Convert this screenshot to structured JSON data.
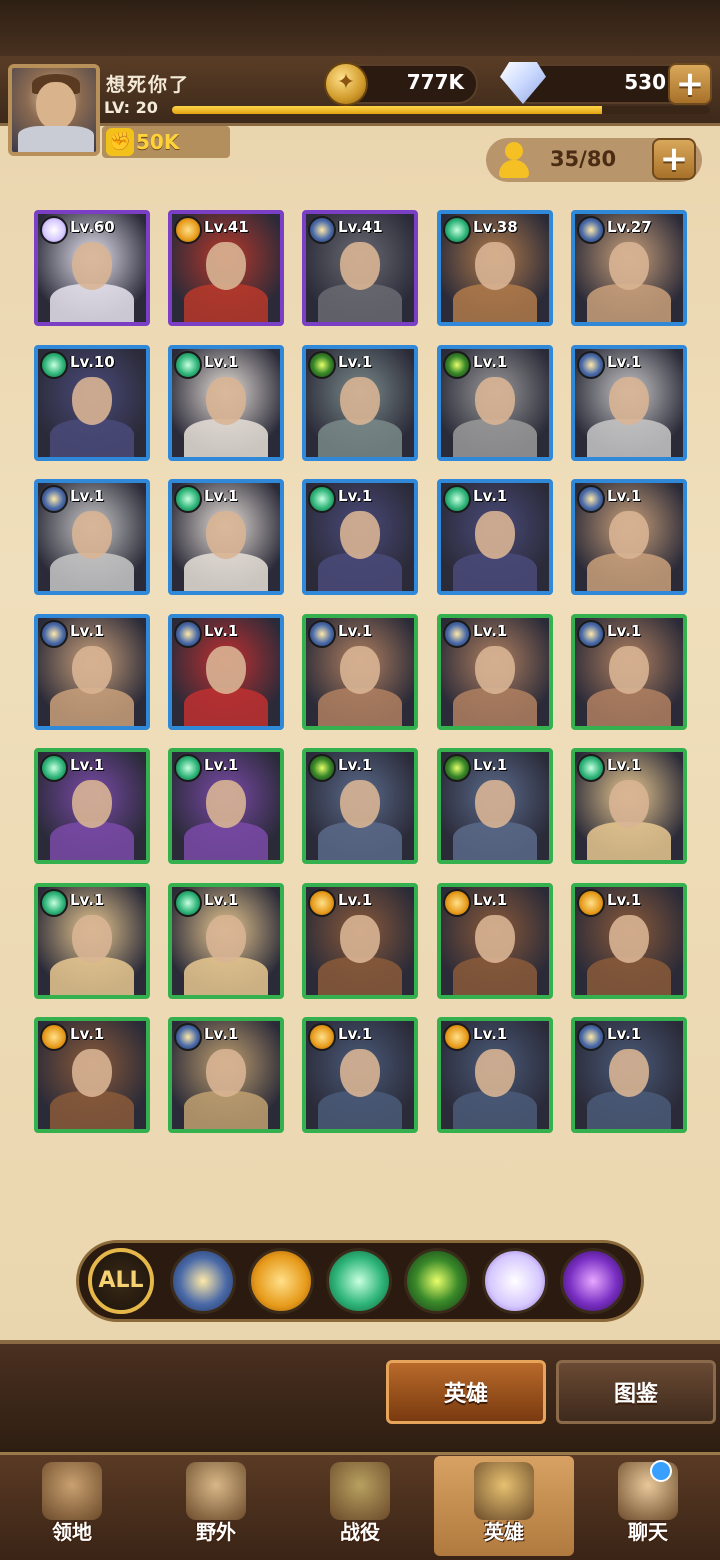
{
  "player": {
    "name": "想死你了",
    "level_label": "LV: 20",
    "xp_fraction": 0.8,
    "power": "50K"
  },
  "resources": {
    "gold": "777K",
    "gems": "530",
    "roster": "35/80"
  },
  "heroes": [
    {
      "level": "Lv.60",
      "element": "light-icon",
      "rarity": "purple",
      "color": "#e8e4f0"
    },
    {
      "level": "Lv.41",
      "element": "fire-icon",
      "rarity": "purple",
      "color": "#b8382a"
    },
    {
      "level": "Lv.41",
      "element": "star-icon",
      "rarity": "purple",
      "color": "#6a6a72"
    },
    {
      "level": "Lv.38",
      "element": "leaf-icon",
      "rarity": "blue",
      "color": "#b07a4a"
    },
    {
      "level": "Lv.27",
      "element": "star-icon",
      "rarity": "blue",
      "color": "#c9a07a"
    },
    {
      "level": "Lv.10",
      "element": "leaf-icon",
      "rarity": "blue",
      "color": "#4a4a7a"
    },
    {
      "level": "Lv.1",
      "element": "leaf-icon",
      "rarity": "blue",
      "color": "#e8e0d8"
    },
    {
      "level": "Lv.1",
      "element": "eye-icon",
      "rarity": "blue",
      "color": "#7a8a8a"
    },
    {
      "level": "Lv.1",
      "element": "eye-icon",
      "rarity": "blue",
      "color": "#9a9a9a"
    },
    {
      "level": "Lv.1",
      "element": "star-icon",
      "rarity": "blue",
      "color": "#c8c8c8"
    },
    {
      "level": "Lv.1",
      "element": "star-icon",
      "rarity": "blue",
      "color": "#c8c8c8"
    },
    {
      "level": "Lv.1",
      "element": "leaf-icon",
      "rarity": "blue",
      "color": "#e8e0d8"
    },
    {
      "level": "Lv.1",
      "element": "leaf-icon",
      "rarity": "blue",
      "color": "#4a4a7a"
    },
    {
      "level": "Lv.1",
      "element": "leaf-icon",
      "rarity": "blue",
      "color": "#4a4a7a"
    },
    {
      "level": "Lv.1",
      "element": "star-icon",
      "rarity": "blue",
      "color": "#c9a07a"
    },
    {
      "level": "Lv.1",
      "element": "star-icon",
      "rarity": "blue",
      "color": "#c9a07a"
    },
    {
      "level": "Lv.1",
      "element": "star-icon",
      "rarity": "blue",
      "color": "#c03030"
    },
    {
      "level": "Lv.1",
      "element": "star-icon",
      "rarity": "green",
      "color": "#b08060"
    },
    {
      "level": "Lv.1",
      "element": "star-icon",
      "rarity": "green",
      "color": "#b08060"
    },
    {
      "level": "Lv.1",
      "element": "star-icon",
      "rarity": "green",
      "color": "#b08060"
    },
    {
      "level": "Lv.1",
      "element": "leaf-icon",
      "rarity": "green",
      "color": "#7a4aa8"
    },
    {
      "level": "Lv.1",
      "element": "leaf-icon",
      "rarity": "green",
      "color": "#7a4aa8"
    },
    {
      "level": "Lv.1",
      "element": "eye-icon",
      "rarity": "green",
      "color": "#5a6a8a"
    },
    {
      "level": "Lv.1",
      "element": "eye-icon",
      "rarity": "green",
      "color": "#5a6a8a"
    },
    {
      "level": "Lv.1",
      "element": "leaf-icon",
      "rarity": "green",
      "color": "#e8c890"
    },
    {
      "level": "Lv.1",
      "element": "leaf-icon",
      "rarity": "green",
      "color": "#e8c890"
    },
    {
      "level": "Lv.1",
      "element": "leaf-icon",
      "rarity": "green",
      "color": "#e8c890"
    },
    {
      "level": "Lv.1",
      "element": "fire-icon",
      "rarity": "green",
      "color": "#8a5a3a"
    },
    {
      "level": "Lv.1",
      "element": "fire-icon",
      "rarity": "green",
      "color": "#8a5a3a"
    },
    {
      "level": "Lv.1",
      "element": "fire-icon",
      "rarity": "green",
      "color": "#8a5a3a"
    },
    {
      "level": "Lv.1",
      "element": "fire-icon",
      "rarity": "green",
      "color": "#8a5a3a"
    },
    {
      "level": "Lv.1",
      "element": "star-icon",
      "rarity": "green",
      "color": "#c0a070"
    },
    {
      "level": "Lv.1",
      "element": "fire-icon",
      "rarity": "green",
      "color": "#4a5a78"
    },
    {
      "level": "Lv.1",
      "element": "fire-icon",
      "rarity": "green",
      "color": "#4a5a78"
    },
    {
      "level": "Lv.1",
      "element": "star-icon",
      "rarity": "green",
      "color": "#4a5a78"
    }
  ],
  "filters": {
    "all_label": "ALL",
    "items": [
      "star-icon",
      "fire-icon",
      "leaf-icon",
      "eye-icon",
      "light-icon",
      "dark-icon"
    ]
  },
  "tabs": {
    "heroes": "英雄",
    "codex": "图鉴"
  },
  "nav": [
    {
      "label": "领地",
      "icon": "castle-icon"
    },
    {
      "label": "野外",
      "icon": "map-scroll-icon"
    },
    {
      "label": "战役",
      "icon": "sword-shield-icon"
    },
    {
      "label": "英雄",
      "icon": "helmet-icon"
    },
    {
      "label": "聊天",
      "icon": "chat-icon"
    }
  ]
}
